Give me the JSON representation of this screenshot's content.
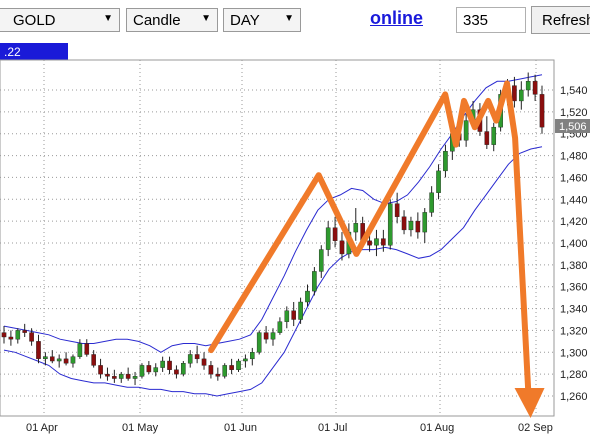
{
  "toolbar": {
    "symbol": "GOLD",
    "chart_style": "Candle",
    "period": "DAY",
    "online_link": "online",
    "count_value": "335",
    "refresh_label": "Refresh"
  },
  "header_strip_text": ".22",
  "price_badge": "1,506",
  "chart_data": {
    "type": "candlestick",
    "y_tick_labels": [
      "1,540",
      "1,520",
      "1,500",
      "1,480",
      "1,460",
      "1,440",
      "1,420",
      "1,400",
      "1,380",
      "1,360",
      "1,340",
      "1,320",
      "1,300",
      "1,280",
      "1,260"
    ],
    "y_ticks": [
      1540,
      1520,
      1500,
      1480,
      1460,
      1440,
      1420,
      1400,
      1380,
      1360,
      1340,
      1320,
      1300,
      1280,
      1260
    ],
    "x_tick_labels": [
      "01 Apr",
      "01 May",
      "01 Jun",
      "01 Jul",
      "01 Aug",
      "02 Sep"
    ],
    "ylim": [
      1250,
      1560
    ],
    "grid": true,
    "colors": {
      "up": "#2e9a2e",
      "down": "#8b0e0e",
      "band": "#2a2ad0",
      "annotation": "#f07a2a",
      "grid": "#9a9a9a"
    },
    "candles": [
      {
        "o": 1318,
        "h": 1324,
        "l": 1308,
        "c": 1314
      },
      {
        "o": 1314,
        "h": 1320,
        "l": 1306,
        "c": 1312
      },
      {
        "o": 1312,
        "h": 1322,
        "l": 1308,
        "c": 1320
      },
      {
        "o": 1320,
        "h": 1326,
        "l": 1314,
        "c": 1318
      },
      {
        "o": 1318,
        "h": 1322,
        "l": 1306,
        "c": 1310
      },
      {
        "o": 1310,
        "h": 1316,
        "l": 1290,
        "c": 1294
      },
      {
        "o": 1294,
        "h": 1300,
        "l": 1288,
        "c": 1296
      },
      {
        "o": 1296,
        "h": 1302,
        "l": 1290,
        "c": 1292
      },
      {
        "o": 1292,
        "h": 1298,
        "l": 1286,
        "c": 1294
      },
      {
        "o": 1294,
        "h": 1300,
        "l": 1288,
        "c": 1290
      },
      {
        "o": 1290,
        "h": 1298,
        "l": 1286,
        "c": 1296
      },
      {
        "o": 1296,
        "h": 1312,
        "l": 1294,
        "c": 1308
      },
      {
        "o": 1308,
        "h": 1312,
        "l": 1296,
        "c": 1298
      },
      {
        "o": 1298,
        "h": 1302,
        "l": 1286,
        "c": 1288
      },
      {
        "o": 1288,
        "h": 1294,
        "l": 1276,
        "c": 1280
      },
      {
        "o": 1280,
        "h": 1286,
        "l": 1274,
        "c": 1278
      },
      {
        "o": 1278,
        "h": 1284,
        "l": 1272,
        "c": 1276
      },
      {
        "o": 1276,
        "h": 1282,
        "l": 1272,
        "c": 1280
      },
      {
        "o": 1280,
        "h": 1286,
        "l": 1274,
        "c": 1276
      },
      {
        "o": 1276,
        "h": 1282,
        "l": 1270,
        "c": 1278
      },
      {
        "o": 1278,
        "h": 1290,
        "l": 1276,
        "c": 1288
      },
      {
        "o": 1288,
        "h": 1292,
        "l": 1280,
        "c": 1282
      },
      {
        "o": 1282,
        "h": 1290,
        "l": 1278,
        "c": 1286
      },
      {
        "o": 1286,
        "h": 1296,
        "l": 1282,
        "c": 1292
      },
      {
        "o": 1292,
        "h": 1296,
        "l": 1280,
        "c": 1284
      },
      {
        "o": 1284,
        "h": 1288,
        "l": 1276,
        "c": 1280
      },
      {
        "o": 1280,
        "h": 1292,
        "l": 1278,
        "c": 1290
      },
      {
        "o": 1290,
        "h": 1302,
        "l": 1286,
        "c": 1298
      },
      {
        "o": 1298,
        "h": 1306,
        "l": 1290,
        "c": 1294
      },
      {
        "o": 1294,
        "h": 1300,
        "l": 1284,
        "c": 1288
      },
      {
        "o": 1288,
        "h": 1292,
        "l": 1276,
        "c": 1280
      },
      {
        "o": 1280,
        "h": 1286,
        "l": 1274,
        "c": 1278
      },
      {
        "o": 1278,
        "h": 1290,
        "l": 1276,
        "c": 1288
      },
      {
        "o": 1288,
        "h": 1294,
        "l": 1280,
        "c": 1284
      },
      {
        "o": 1284,
        "h": 1294,
        "l": 1282,
        "c": 1292
      },
      {
        "o": 1292,
        "h": 1298,
        "l": 1286,
        "c": 1294
      },
      {
        "o": 1294,
        "h": 1304,
        "l": 1288,
        "c": 1300
      },
      {
        "o": 1300,
        "h": 1320,
        "l": 1298,
        "c": 1318
      },
      {
        "o": 1318,
        "h": 1324,
        "l": 1308,
        "c": 1312
      },
      {
        "o": 1312,
        "h": 1322,
        "l": 1306,
        "c": 1318
      },
      {
        "o": 1318,
        "h": 1332,
        "l": 1316,
        "c": 1328
      },
      {
        "o": 1328,
        "h": 1342,
        "l": 1322,
        "c": 1338
      },
      {
        "o": 1338,
        "h": 1346,
        "l": 1324,
        "c": 1330
      },
      {
        "o": 1330,
        "h": 1350,
        "l": 1326,
        "c": 1346
      },
      {
        "o": 1346,
        "h": 1362,
        "l": 1342,
        "c": 1356
      },
      {
        "o": 1356,
        "h": 1378,
        "l": 1352,
        "c": 1374
      },
      {
        "o": 1374,
        "h": 1398,
        "l": 1368,
        "c": 1394
      },
      {
        "o": 1394,
        "h": 1420,
        "l": 1388,
        "c": 1414
      },
      {
        "o": 1414,
        "h": 1424,
        "l": 1396,
        "c": 1402
      },
      {
        "o": 1402,
        "h": 1410,
        "l": 1384,
        "c": 1390
      },
      {
        "o": 1390,
        "h": 1418,
        "l": 1386,
        "c": 1410
      },
      {
        "o": 1410,
        "h": 1432,
        "l": 1402,
        "c": 1418
      },
      {
        "o": 1418,
        "h": 1424,
        "l": 1396,
        "c": 1402
      },
      {
        "o": 1402,
        "h": 1410,
        "l": 1392,
        "c": 1398
      },
      {
        "o": 1398,
        "h": 1412,
        "l": 1388,
        "c": 1404
      },
      {
        "o": 1404,
        "h": 1412,
        "l": 1392,
        "c": 1398
      },
      {
        "o": 1398,
        "h": 1440,
        "l": 1394,
        "c": 1436
      },
      {
        "o": 1436,
        "h": 1446,
        "l": 1418,
        "c": 1424
      },
      {
        "o": 1424,
        "h": 1430,
        "l": 1408,
        "c": 1412
      },
      {
        "o": 1412,
        "h": 1424,
        "l": 1406,
        "c": 1420
      },
      {
        "o": 1420,
        "h": 1428,
        "l": 1404,
        "c": 1410
      },
      {
        "o": 1410,
        "h": 1432,
        "l": 1400,
        "c": 1428
      },
      {
        "o": 1428,
        "h": 1452,
        "l": 1424,
        "c": 1446
      },
      {
        "o": 1446,
        "h": 1472,
        "l": 1440,
        "c": 1466
      },
      {
        "o": 1466,
        "h": 1490,
        "l": 1460,
        "c": 1484
      },
      {
        "o": 1484,
        "h": 1508,
        "l": 1476,
        "c": 1500
      },
      {
        "o": 1500,
        "h": 1514,
        "l": 1488,
        "c": 1494
      },
      {
        "o": 1494,
        "h": 1518,
        "l": 1488,
        "c": 1512
      },
      {
        "o": 1512,
        "h": 1530,
        "l": 1504,
        "c": 1522
      },
      {
        "o": 1522,
        "h": 1528,
        "l": 1498,
        "c": 1502
      },
      {
        "o": 1502,
        "h": 1516,
        "l": 1486,
        "c": 1490
      },
      {
        "o": 1490,
        "h": 1510,
        "l": 1484,
        "c": 1506
      },
      {
        "o": 1506,
        "h": 1540,
        "l": 1502,
        "c": 1536
      },
      {
        "o": 1536,
        "h": 1550,
        "l": 1526,
        "c": 1544
      },
      {
        "o": 1544,
        "h": 1552,
        "l": 1524,
        "c": 1530
      },
      {
        "o": 1530,
        "h": 1548,
        "l": 1522,
        "c": 1540
      },
      {
        "o": 1540,
        "h": 1556,
        "l": 1534,
        "c": 1548
      },
      {
        "o": 1548,
        "h": 1554,
        "l": 1530,
        "c": 1536
      },
      {
        "o": 1536,
        "h": 1544,
        "l": 1500,
        "c": 1506
      }
    ],
    "upper_band": [
      1324,
      1322,
      1320,
      1318,
      1316,
      1312,
      1310,
      1308,
      1308,
      1310,
      1312,
      1312,
      1310,
      1306,
      1300,
      1306,
      1308,
      1308,
      1306,
      1308,
      1310,
      1312,
      1316,
      1330,
      1350,
      1370,
      1392,
      1412,
      1430,
      1440,
      1444,
      1450,
      1448,
      1440,
      1436,
      1438,
      1444,
      1456,
      1470,
      1486,
      1500,
      1516,
      1530,
      1542,
      1548,
      1548,
      1550,
      1552,
      1554
    ],
    "lower_band": [
      1302,
      1300,
      1296,
      1292,
      1288,
      1280,
      1276,
      1274,
      1272,
      1272,
      1270,
      1268,
      1268,
      1266,
      1266,
      1264,
      1264,
      1262,
      1262,
      1260,
      1262,
      1264,
      1266,
      1272,
      1286,
      1300,
      1320,
      1340,
      1360,
      1376,
      1386,
      1392,
      1394,
      1394,
      1396,
      1394,
      1390,
      1386,
      1388,
      1394,
      1404,
      1414,
      1430,
      1444,
      1458,
      1472,
      1482,
      1486,
      1488
    ],
    "annotation_path": [
      [
        1302,
        0.385
      ],
      [
        1462,
        0.585
      ],
      [
        1390,
        0.655
      ],
      [
        1536,
        0.82
      ],
      [
        1490,
        0.84
      ],
      [
        1530,
        0.855
      ],
      [
        1506,
        0.875
      ],
      [
        1530,
        0.9
      ],
      [
        1512,
        0.915
      ],
      [
        1546,
        0.935
      ],
      [
        1496,
        0.95
      ],
      [
        1260,
        0.975
      ]
    ]
  }
}
